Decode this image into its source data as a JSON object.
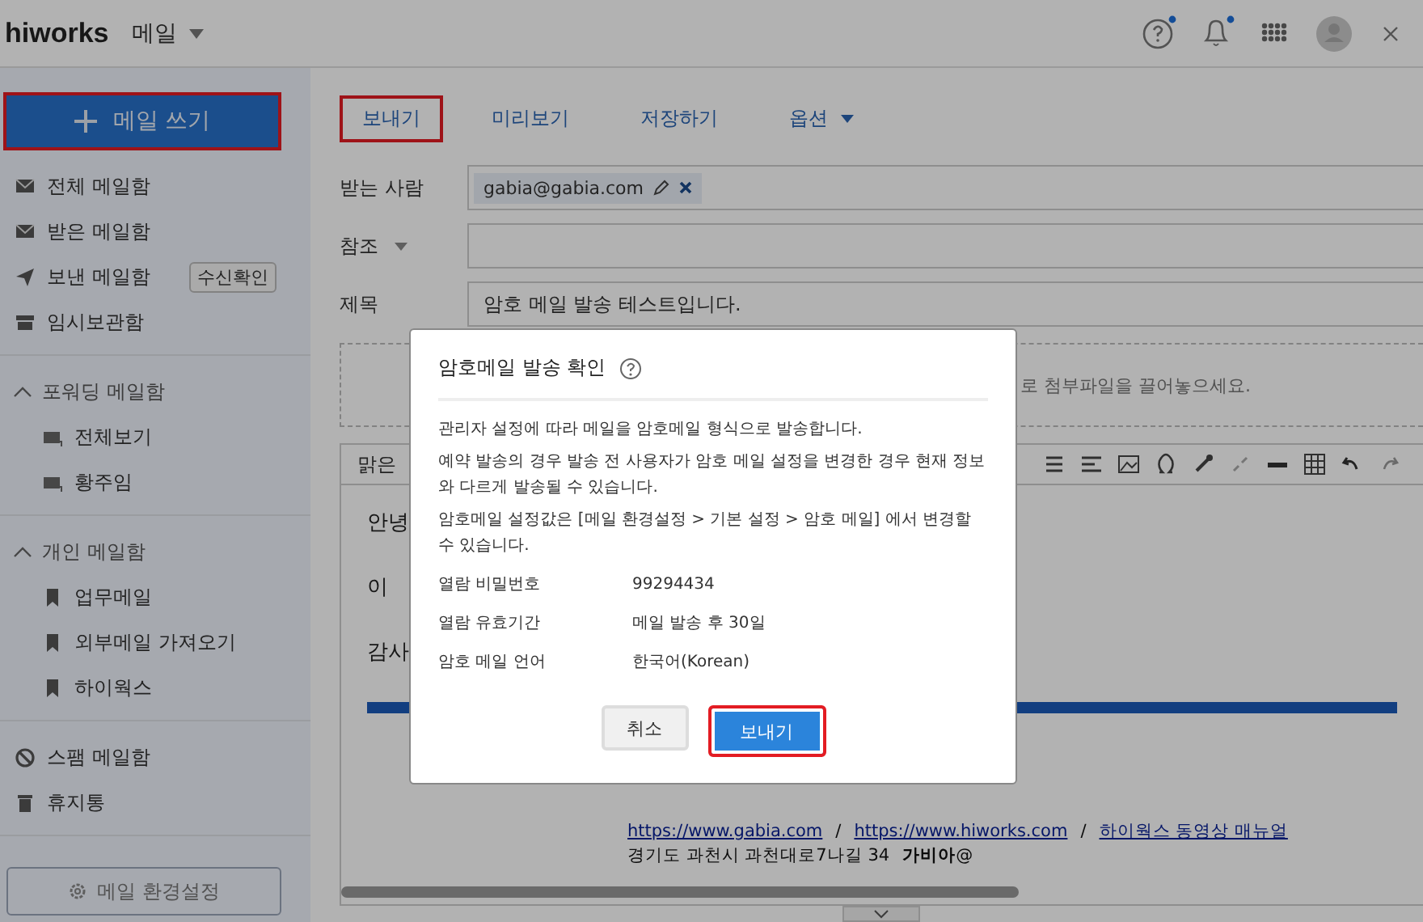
{
  "header": {
    "logo": "hiworks",
    "app": "메일",
    "icons": [
      {
        "kind": "help",
        "dot": true
      },
      {
        "kind": "bell",
        "dot": true
      },
      {
        "kind": "apps",
        "dot": false
      },
      {
        "kind": "avatar",
        "dot": false
      },
      {
        "kind": "close",
        "dot": false
      }
    ]
  },
  "sidebar": {
    "compose": {
      "label": "메일 쓰기",
      "highlighted": true
    },
    "groups": [
      {
        "items": [
          {
            "label": "전체 메일함",
            "kind": "envelope"
          },
          {
            "label": "받은 메일함",
            "kind": "envelope"
          },
          {
            "label": "보낸 메일함",
            "kind": "plane",
            "badge": "수신확인"
          },
          {
            "label": "임시보관함",
            "kind": "archive"
          }
        ]
      },
      {
        "title": "포워딩 메일함",
        "expanded": true,
        "items": [
          {
            "label": "전체보기",
            "kind": "forward"
          },
          {
            "label": "황주임",
            "kind": "forward"
          }
        ]
      },
      {
        "title": "개인 메일함",
        "expanded": true,
        "items": [
          {
            "label": "업무메일",
            "kind": "bookmark"
          },
          {
            "label": "외부메일 가져오기",
            "kind": "bookmark"
          },
          {
            "label": "하이웍스",
            "kind": "bookmark"
          }
        ]
      },
      {
        "items": [
          {
            "label": "스팸 메일함",
            "kind": "ban"
          },
          {
            "label": "휴지통",
            "kind": "trash"
          }
        ]
      }
    ],
    "settings": {
      "label": "메일 환경설정"
    }
  },
  "compose": {
    "toolbar": [
      {
        "label": "보내기",
        "kind": "button",
        "highlighted": true
      },
      {
        "label": "미리보기",
        "kind": "button",
        "highlighted": false
      },
      {
        "label": "저장하기",
        "kind": "button",
        "highlighted": false
      },
      {
        "label": "옵션",
        "kind": "dropdown",
        "highlighted": false
      }
    ],
    "fields": [
      {
        "label": "받는 사람",
        "kind": "recipients",
        "chips": [
          "gabia@gabia.com"
        ]
      },
      {
        "label": "참조",
        "kind": "dropdown-label"
      },
      {
        "label": "제목",
        "kind": "text",
        "value": "암호 메일 발송 테스트입니다."
      }
    ],
    "attach_hint": "로 첨부파일을 끌어놓으세요.",
    "font": "맑은",
    "body_lines": [
      "안녕",
      "이",
      "감사"
    ],
    "signature": [
      {
        "parts": [
          {
            "text": "https://www.gabia.com",
            "kind": "link"
          },
          {
            "text": "/",
            "kind": "text"
          },
          {
            "text": "https://www.hiworks.com",
            "kind": "link"
          },
          {
            "text": "/",
            "kind": "text"
          },
          {
            "text": "하이웍스 동영상 매뉴얼",
            "kind": "link"
          }
        ]
      },
      {
        "parts": [
          {
            "text": "경기도 과천시 과천대로7나길 34",
            "kind": "text"
          },
          {
            "text": "가비아",
            "kind": "bold"
          },
          {
            "text": "@",
            "kind": "text"
          }
        ]
      }
    ]
  },
  "modal": {
    "title": "암호메일 발송 확인",
    "paragraphs": [
      "관리자 설정에 따라 메일을 암호메일 형식으로 발송합니다.",
      "예약 발송의 경우 발송 전 사용자가 암호 메일 설정을 변경한 경우 현재 정보와 다르게 발송될 수 있습니다.",
      "암호메일 설정값은 [메일 환경설정 > 기본 설정 > 암호 메일] 에서 변경할 수 있습니다."
    ],
    "details": [
      {
        "label": "열람 비밀번호",
        "value": "99294434"
      },
      {
        "label": "열람 유효기간",
        "value": "메일 발송 후 30일"
      },
      {
        "label": "암호 메일 언어",
        "value": "한국어(Korean)"
      }
    ],
    "buttons": [
      {
        "label": "취소",
        "kind": "secondary",
        "highlighted": false
      },
      {
        "label": "보내기",
        "kind": "primary",
        "highlighted": true
      }
    ]
  }
}
